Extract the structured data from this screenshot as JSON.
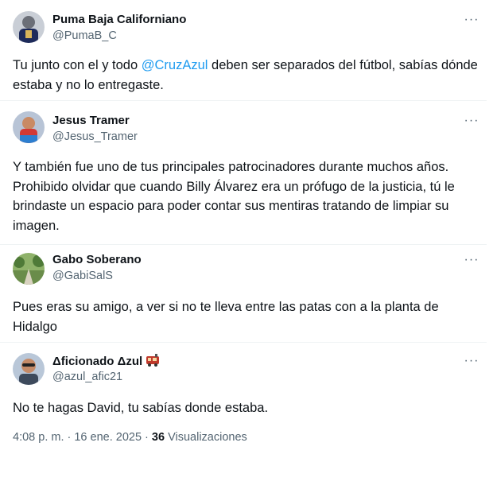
{
  "replies": [
    {
      "name": "Puma Baja Californiano",
      "handle": "@PumaB_C",
      "text_before": "Tu junto con el y todo ",
      "mention": "@CruzAzul",
      "text_after": " deben ser separados del fútbol, sabías dónde estaba y no lo entregaste.",
      "more_icon": "···"
    },
    {
      "name": "Jesus Tramer",
      "handle": "@Jesus_Tramer",
      "text": "Y también fue uno de tus principales patrocinadores durante muchos años. Prohibido olvidar que cuando Billy Álvarez era un prófugo de la justicia, tú le brindaste un espacio para poder contar sus mentiras tratando de limpiar su imagen.",
      "more_icon": "···"
    },
    {
      "name": "Gabo Soberano",
      "handle": "@GabiSalS",
      "text": "Pues eras su amigo, a ver si no te lleva entre las patas con a la planta de Hidalgo",
      "more_icon": "···"
    },
    {
      "name": "Δficionado Δzul",
      "handle": "@azul_afic21",
      "text": "No te hagas David, tu sabías donde estaba.",
      "more_icon": "···",
      "emoji": "train-emoji"
    }
  ],
  "meta": {
    "time": "4:08 p. m. · 16 ene. 2025 · ",
    "views_count": "36",
    "views_label": " Visualizaciones"
  },
  "colors": {
    "text": "#0f1419",
    "secondary": "#536471",
    "link": "#1d9bf0",
    "divider": "#eff3f4"
  }
}
